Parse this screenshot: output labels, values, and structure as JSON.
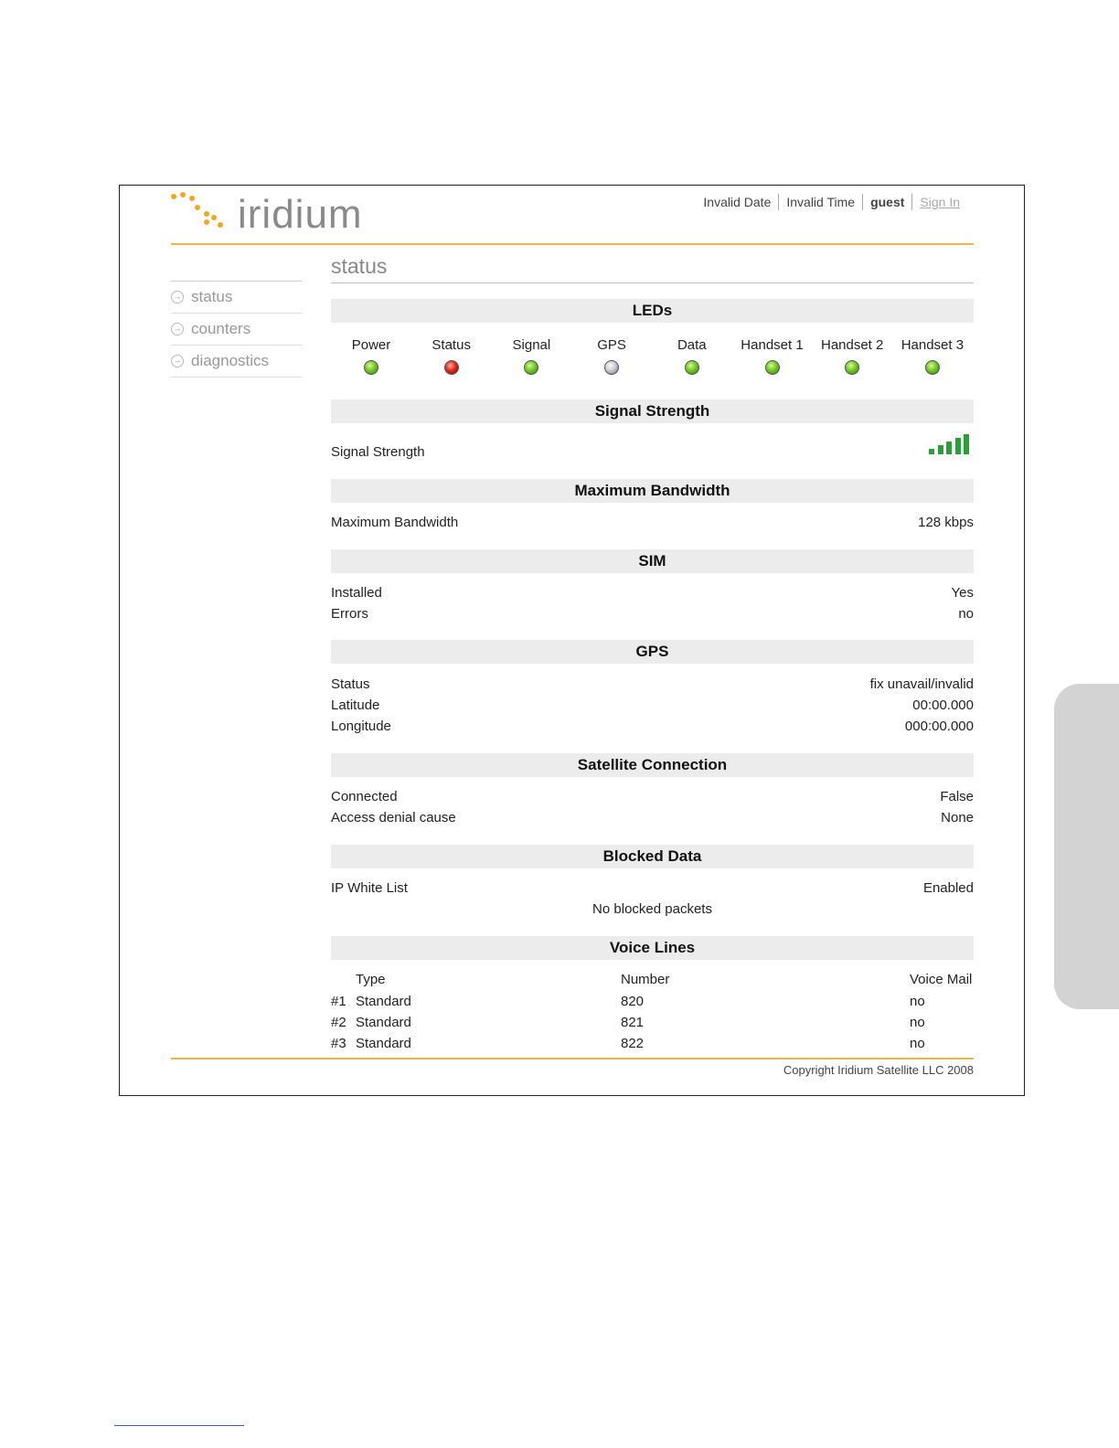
{
  "header": {
    "logo_text": "iridium",
    "date": "Invalid Date",
    "time": "Invalid Time",
    "user": "guest",
    "signin": "Sign In",
    "accent_color": "#f0b34a"
  },
  "sidebar": {
    "items": [
      {
        "label": "status",
        "icon": "arrow-right-circle-icon"
      },
      {
        "label": "counters",
        "icon": "arrow-right-circle-icon"
      },
      {
        "label": "diagnostics",
        "icon": "arrow-right-circle-icon"
      }
    ]
  },
  "page": {
    "title": "status"
  },
  "leds": {
    "heading": "LEDs",
    "items": [
      {
        "label": "Power",
        "color": "green"
      },
      {
        "label": "Status",
        "color": "red"
      },
      {
        "label": "Signal",
        "color": "green"
      },
      {
        "label": "GPS",
        "color": "gray"
      },
      {
        "label": "Data",
        "color": "green"
      },
      {
        "label": "Handset 1",
        "color": "green"
      },
      {
        "label": "Handset 2",
        "color": "green"
      },
      {
        "label": "Handset 3",
        "color": "green"
      }
    ]
  },
  "signal": {
    "heading": "Signal Strength",
    "label": "Signal Strength",
    "bars": 5,
    "max_bars": 5,
    "color": "#27a036"
  },
  "bandwidth": {
    "heading": "Maximum Bandwidth",
    "label": "Maximum Bandwidth",
    "value": "128 kbps"
  },
  "sim": {
    "heading": "SIM",
    "rows": [
      {
        "label": "Installed",
        "value": "Yes"
      },
      {
        "label": "Errors",
        "value": "no"
      }
    ]
  },
  "gps": {
    "heading": "GPS",
    "rows": [
      {
        "label": "Status",
        "value": "fix unavail/invalid"
      },
      {
        "label": "Latitude",
        "value": "00:00.000"
      },
      {
        "label": "Longitude",
        "value": "000:00.000"
      }
    ]
  },
  "satellite": {
    "heading": "Satellite Connection",
    "rows": [
      {
        "label": "Connected",
        "value": "False"
      },
      {
        "label": "Access denial cause",
        "value": "None"
      }
    ]
  },
  "blocked": {
    "heading": "Blocked Data",
    "label": "IP White List",
    "value": "Enabled",
    "message": "No blocked packets"
  },
  "voice": {
    "heading": "Voice Lines",
    "columns": [
      "Type",
      "Number",
      "Voice Mail"
    ],
    "rows": [
      {
        "idx": "#1",
        "type": "Standard",
        "number": "820",
        "voicemail": "no"
      },
      {
        "idx": "#2",
        "type": "Standard",
        "number": "821",
        "voicemail": "no"
      },
      {
        "idx": "#3",
        "type": "Standard",
        "number": "822",
        "voicemail": "no"
      }
    ]
  },
  "footer": {
    "copyright": "Copyright Iridium Satellite LLC 2008"
  }
}
